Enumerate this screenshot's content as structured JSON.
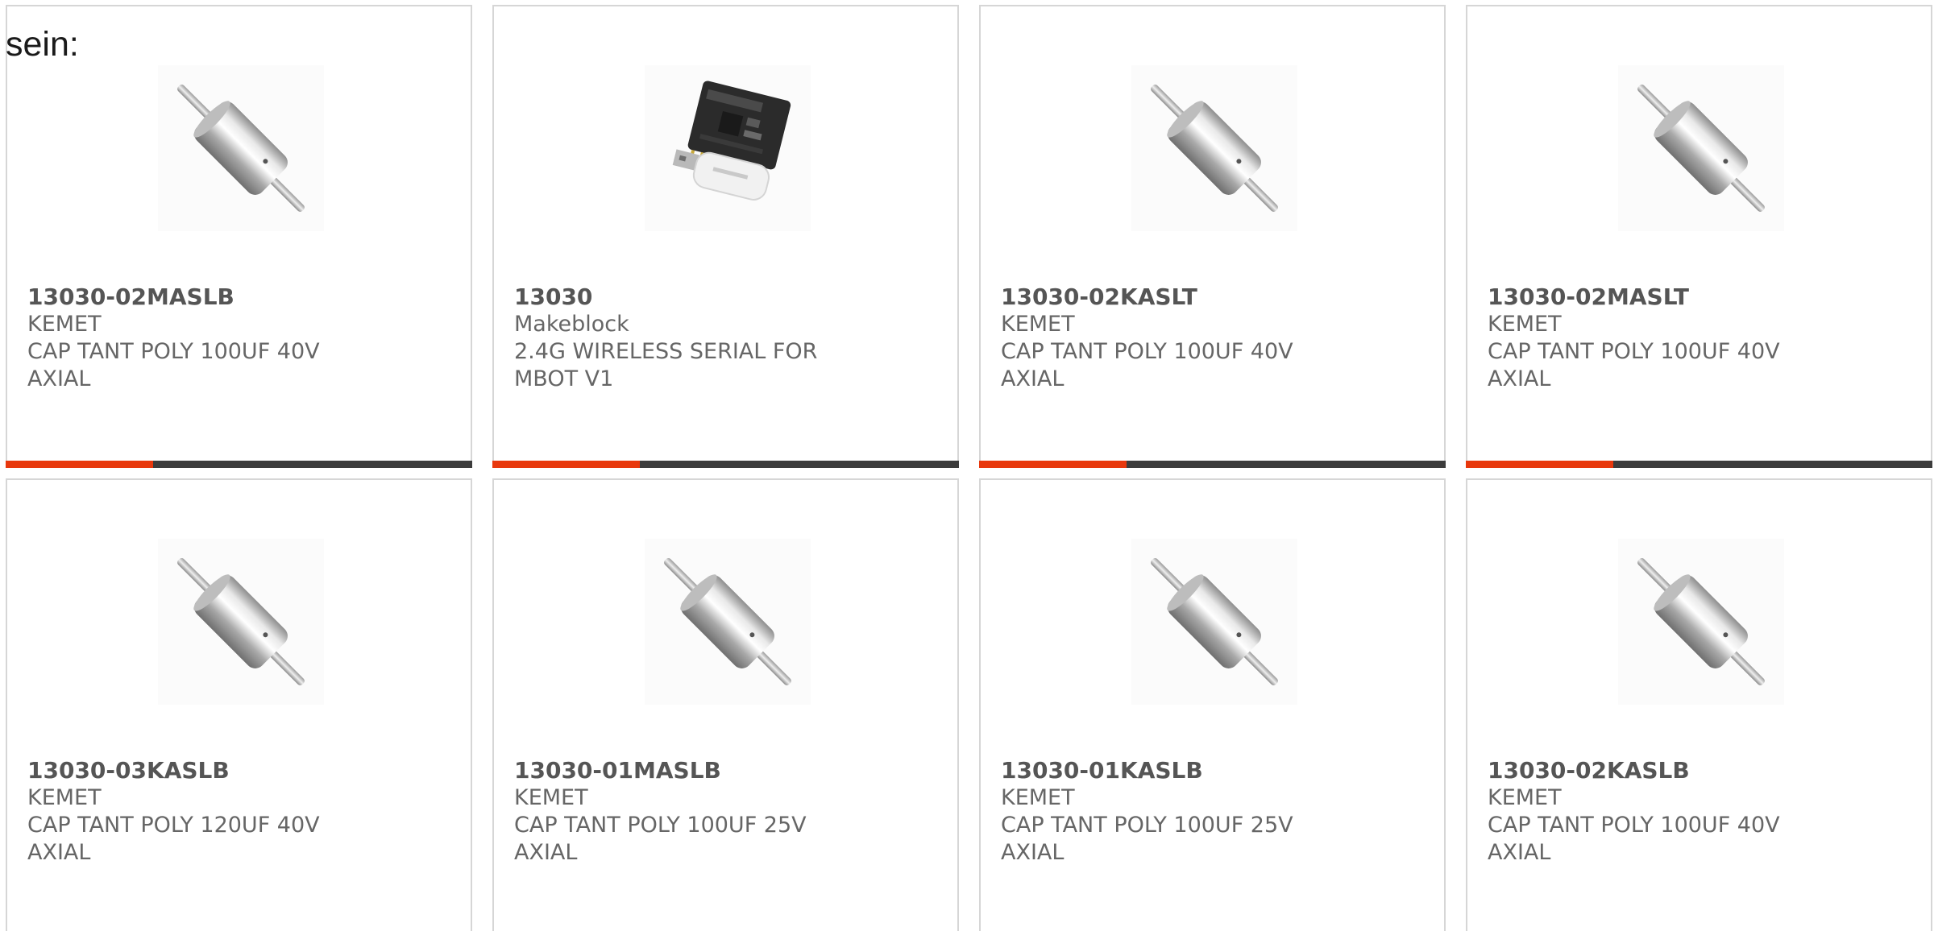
{
  "intro_text": "sein:",
  "colors": {
    "accent": "#e8380d",
    "bar": "#3c3c3c",
    "border": "#d6d6d6",
    "part_text": "#555555",
    "body_text": "#666666"
  },
  "products": [
    {
      "part": "13030-02MASLB",
      "manufacturer": "KEMET",
      "description": "CAP TANT POLY 100UF 40V AXIAL",
      "image_icon": "axial-capacitor-image"
    },
    {
      "part": "13030",
      "manufacturer": "Makeblock",
      "description": "2.4G WIRELESS SERIAL FOR MBOT V1",
      "image_icon": "wireless-module-image"
    },
    {
      "part": "13030-02KASLT",
      "manufacturer": "KEMET",
      "description": "CAP TANT POLY 100UF 40V AXIAL",
      "image_icon": "axial-capacitor-image"
    },
    {
      "part": "13030-02MASLT",
      "manufacturer": "KEMET",
      "description": "CAP TANT POLY 100UF 40V AXIAL",
      "image_icon": "axial-capacitor-image"
    },
    {
      "part": "13030-03KASLB",
      "manufacturer": "KEMET",
      "description": "CAP TANT POLY 120UF 40V AXIAL",
      "image_icon": "axial-capacitor-image"
    },
    {
      "part": "13030-01MASLB",
      "manufacturer": "KEMET",
      "description": "CAP TANT POLY 100UF 25V AXIAL",
      "image_icon": "axial-capacitor-image"
    },
    {
      "part": "13030-01KASLB",
      "manufacturer": "KEMET",
      "description": "CAP TANT POLY 100UF 25V AXIAL",
      "image_icon": "axial-capacitor-image"
    },
    {
      "part": "13030-02KASLB",
      "manufacturer": "KEMET",
      "description": "CAP TANT POLY 100UF 40V AXIAL",
      "image_icon": "axial-capacitor-image"
    }
  ]
}
